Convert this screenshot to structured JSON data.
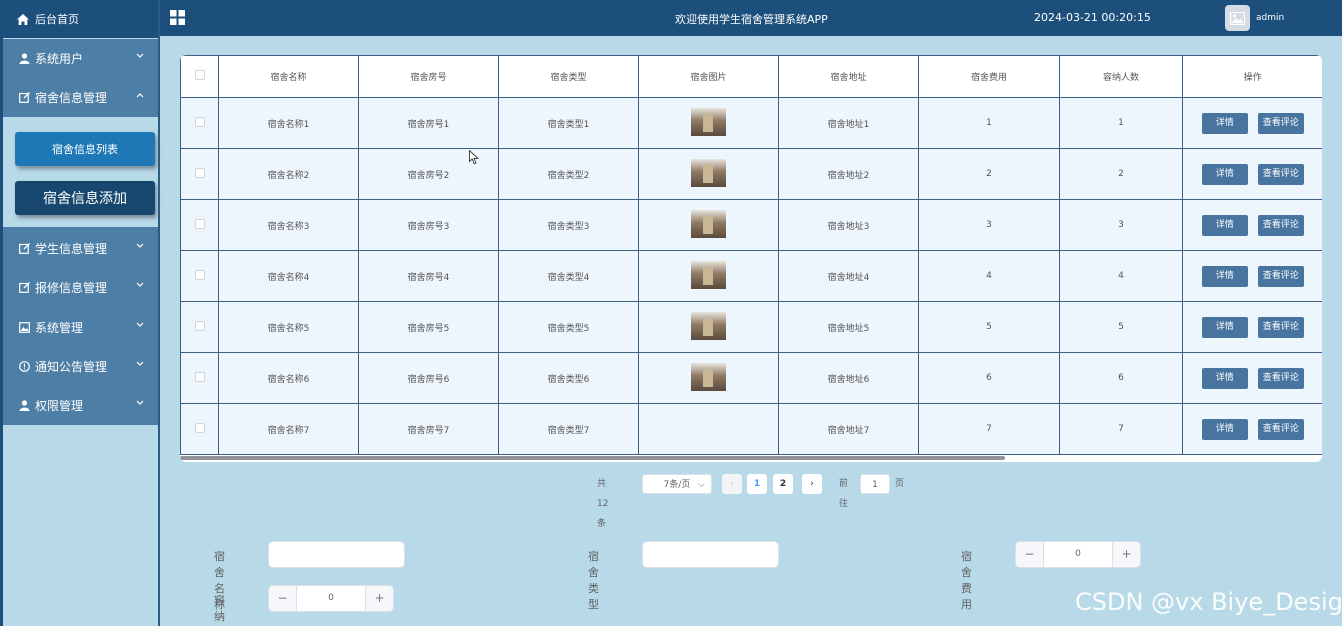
{
  "sidebar": {
    "home_label": "后台首页",
    "items": [
      {
        "label": "系统用户",
        "icon": "user-icon"
      },
      {
        "label": "宿舍信息管理",
        "icon": "edit-icon"
      },
      {
        "label": "学生信息管理",
        "icon": "edit-icon"
      },
      {
        "label": "报修信息管理",
        "icon": "edit-icon"
      },
      {
        "label": "系统管理",
        "icon": "image-icon"
      },
      {
        "label": "通知公告管理",
        "icon": "info-icon"
      },
      {
        "label": "权限管理",
        "icon": "user-icon"
      }
    ],
    "submenu": [
      "宿舍信息列表",
      "宿舍信息添加"
    ]
  },
  "header": {
    "title": "欢迎使用学生宿舍管理系统APP",
    "datetime": "2024-03-21 00:20:15",
    "username": "admin"
  },
  "table": {
    "columns": [
      "宿舍名称",
      "宿舍房号",
      "宿舍类型",
      "宿舍图片",
      "宿舍地址",
      "宿舍费用",
      "容纳人数",
      "操作"
    ],
    "rows": [
      {
        "name": "宿舍名称1",
        "room": "宿舍房号1",
        "type": "宿舍类型1",
        "address": "宿舍地址1",
        "fee": "1",
        "capacity": "1"
      },
      {
        "name": "宿舍名称2",
        "room": "宿舍房号2",
        "type": "宿舍类型2",
        "address": "宿舍地址2",
        "fee": "2",
        "capacity": "2"
      },
      {
        "name": "宿舍名称3",
        "room": "宿舍房号3",
        "type": "宿舍类型3",
        "address": "宿舍地址3",
        "fee": "3",
        "capacity": "3"
      },
      {
        "name": "宿舍名称4",
        "room": "宿舍房号4",
        "type": "宿舍类型4",
        "address": "宿舍地址4",
        "fee": "4",
        "capacity": "4"
      },
      {
        "name": "宿舍名称5",
        "room": "宿舍房号5",
        "type": "宿舍类型5",
        "address": "宿舍地址5",
        "fee": "5",
        "capacity": "5"
      },
      {
        "name": "宿舍名称6",
        "room": "宿舍房号6",
        "type": "宿舍类型6",
        "address": "宿舍地址6",
        "fee": "6",
        "capacity": "6"
      },
      {
        "name": "宿舍名称7",
        "room": "宿舍房号7",
        "type": "宿舍类型7",
        "address": "宿舍地址7",
        "fee": "7",
        "capacity": "7"
      }
    ],
    "detail_label": "详情",
    "comment_label": "查看评论"
  },
  "pagination": {
    "total": "共 12 条",
    "page_size": "7条/页",
    "prev": "‹",
    "pages": [
      "1",
      "2"
    ],
    "next": "›",
    "goto_label": "前往",
    "goto_value": "1",
    "page_suffix": "页"
  },
  "form": {
    "name_label": "宿舍名称",
    "type_label": "宿舍类型",
    "fee_label": "宿舍费用",
    "fee_value": "0",
    "capacity_label": "容纳人数",
    "capacity_value": "0",
    "minus": "−",
    "plus": "+"
  },
  "watermark": "CSDN @vx Biye_Design",
  "colors": {
    "accent": "#1d4f7c",
    "sidebar_menu": "#4d7ea6",
    "background": "#b8d9e7",
    "action_button": "#4875a0"
  }
}
